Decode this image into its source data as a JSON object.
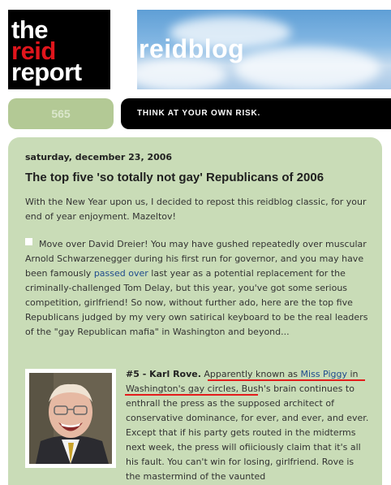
{
  "header": {
    "logo_lines": [
      "the",
      "reid",
      "report"
    ],
    "banner_title": "reidblog",
    "counter": "565",
    "tagline": "THINK AT YOUR OWN RISK."
  },
  "post": {
    "date": "saturday, december 23, 2006",
    "title": "The top five 'so totally not gay' Republicans of 2006",
    "intro": "With the New Year upon us, I decided to repost this reidblog classic, for your end of year enjoyment. Mazeltov!",
    "para_before_link": "Move over David Dreier! You may have gushed repeatedly over muscular Arnold Schwarzenegger during his first run for governor, and you may have been famously ",
    "para_link": "passed over",
    "para_after_link": " last year as a potential replacement for the criminally-challenged Tom Delay, but this year, you've got some serious competition, girlfriend! So now, without further ado, here are the top five Republicans judged by my very own satirical keyboard to be the real leaders of the \"gay Republican mafia\" in Washington and beyond...",
    "section": {
      "heading": "#5 - Karl Rove.",
      "text_before_link": " Apparently known as ",
      "link": "Miss Piggy",
      "text_after_link": " in Washington's gay circles, Bush's brain continues to enthrall the press as the supposed architect of conservative dominance, for ever, and ever, and ever. Except that if his party gets routed in the midterms next week, the press will ofiiciously claim that it's all his fault. You can't win for losing, girlfriend. Rove is the mastermind of the vaunted"
    },
    "photo_icon": "karl-rove-photo"
  }
}
